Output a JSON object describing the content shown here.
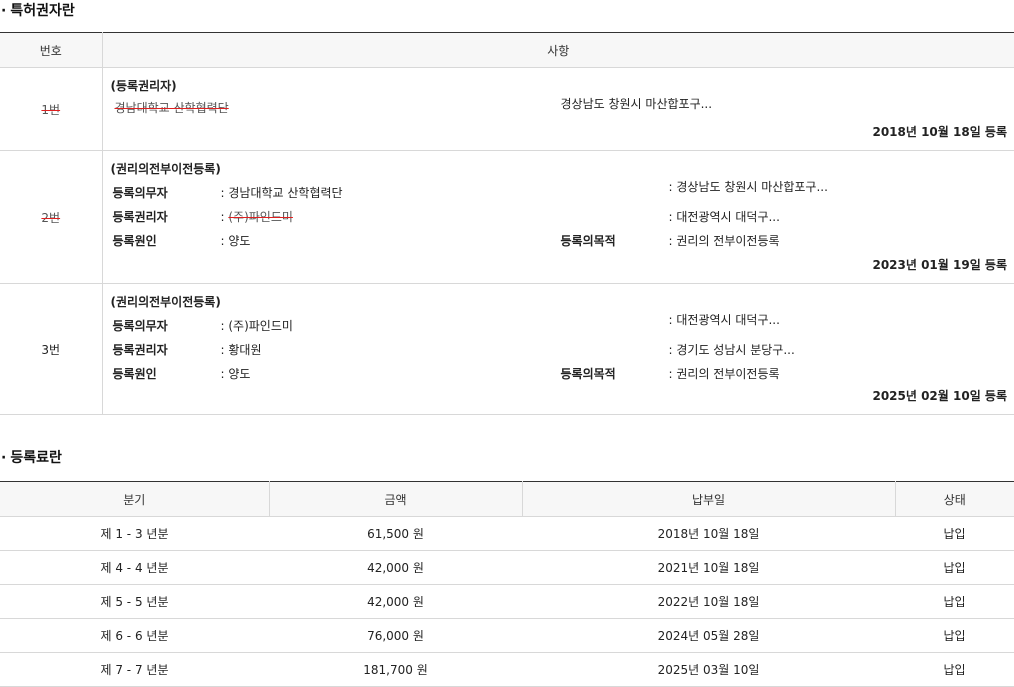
{
  "rights_section": {
    "bullet": "·",
    "title": "특허권자란"
  },
  "rights_table": {
    "headers": {
      "no": "번호",
      "detail": "사항"
    },
    "rows": [
      {
        "no": "1번",
        "kind": "(등록권리자)",
        "holder": "경남대학교 산학협력단",
        "address": "경상남도 창원시 마산합포구...",
        "date": "2018년 10월 18일 등록"
      },
      {
        "no": "2번",
        "kind": "(권리의전부이전등록)",
        "obligor_label": "등록의무자",
        "obligor_value": ": 경남대학교 산학협력단",
        "obligor_addr": ": 경상남도 창원시 마산합포구...",
        "holder_label": "등록권리자",
        "holder_prefix": ": ",
        "holder_value": "(주)파인드미",
        "holder_addr": ": 대전광역시 대덕구...",
        "cause_label": "등록원인",
        "cause_value": ": 양도",
        "purpose_label": "등록의목적",
        "purpose_value": ": 권리의 전부이전등록",
        "date": "2023년 01월 19일 등록"
      },
      {
        "no": "3번",
        "kind": "(권리의전부이전등록)",
        "obligor_label": "등록의무자",
        "obligor_value": ": (주)파인드미",
        "obligor_addr": ": 대전광역시 대덕구...",
        "holder_label": "등록권리자",
        "holder_value": ": 황대원",
        "holder_addr": ": 경기도 성남시 분당구...",
        "cause_label": "등록원인",
        "cause_value": ": 양도",
        "purpose_label": "등록의목적",
        "purpose_value": ": 권리의 전부이전등록",
        "date": "2025년 02월 10일 등록"
      }
    ]
  },
  "fees_section": {
    "bullet": "·",
    "title": "등록료란"
  },
  "fees_table": {
    "headers": {
      "period": "분기",
      "amount": "금액",
      "paid_date": "납부일",
      "status": "상태"
    },
    "rows": [
      {
        "period": "제 1 - 3 년분",
        "amount": "61,500 원",
        "paid_date": "2018년 10월 18일",
        "status": "납입"
      },
      {
        "period": "제 4 - 4 년분",
        "amount": "42,000 원",
        "paid_date": "2021년 10월 18일",
        "status": "납입"
      },
      {
        "period": "제 5 - 5 년분",
        "amount": "42,000 원",
        "paid_date": "2022년 10월 18일",
        "status": "납입"
      },
      {
        "period": "제 6 - 6 년분",
        "amount": "76,000 원",
        "paid_date": "2024년 05월 28일",
        "status": "납입"
      },
      {
        "period": "제 7 - 7 년분",
        "amount": "181,700 원",
        "paid_date": "2025년 03월 10일",
        "status": "납입"
      }
    ]
  }
}
